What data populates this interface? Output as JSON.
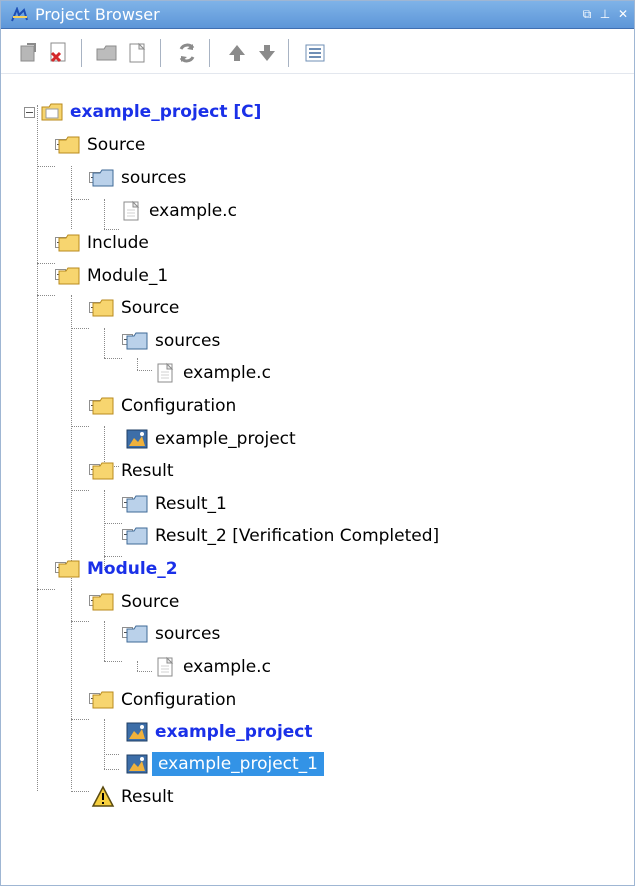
{
  "window": {
    "title": "Project Browser",
    "buttons": [
      "restore-icon",
      "pin-icon",
      "close-icon"
    ]
  },
  "toolbar": {
    "items": [
      {
        "name": "add-file-icon"
      },
      {
        "name": "delete-file-icon"
      },
      {
        "name": "new-folder-icon"
      },
      {
        "name": "new-file-icon"
      },
      {
        "name": "refresh-icon"
      },
      {
        "name": "up-arrow-icon"
      },
      {
        "name": "down-arrow-icon"
      },
      {
        "name": "properties-icon"
      }
    ]
  },
  "tree": {
    "nodes": [
      {
        "label": "example_project [C]",
        "type": "project-folder",
        "style": "bold-blue"
      },
      {
        "label": "Source",
        "type": "folder"
      },
      {
        "label": "sources",
        "type": "folder-blue"
      },
      {
        "label": "example.c",
        "type": "file"
      },
      {
        "label": "Include",
        "type": "folder"
      },
      {
        "label": "Module_1",
        "type": "folder"
      },
      {
        "label": "Source",
        "type": "folder"
      },
      {
        "label": "sources",
        "type": "folder-blue"
      },
      {
        "label": "example.c",
        "type": "file"
      },
      {
        "label": "Configuration",
        "type": "folder"
      },
      {
        "label": "example_project",
        "type": "config"
      },
      {
        "label": "Result",
        "type": "folder"
      },
      {
        "label": "Result_1",
        "type": "folder-blue"
      },
      {
        "label": "Result_2 [Verification Completed]",
        "type": "folder-blue"
      },
      {
        "label": "Module_2",
        "type": "folder",
        "style": "bold-blue"
      },
      {
        "label": "Source",
        "type": "folder"
      },
      {
        "label": "sources",
        "type": "folder-blue"
      },
      {
        "label": "example.c",
        "type": "file"
      },
      {
        "label": "Configuration",
        "type": "folder"
      },
      {
        "label": "example_project",
        "type": "config",
        "style": "bold-blue"
      },
      {
        "label": "example_project_1",
        "type": "config",
        "selected": true
      },
      {
        "label": "Result",
        "type": "warning"
      }
    ]
  }
}
